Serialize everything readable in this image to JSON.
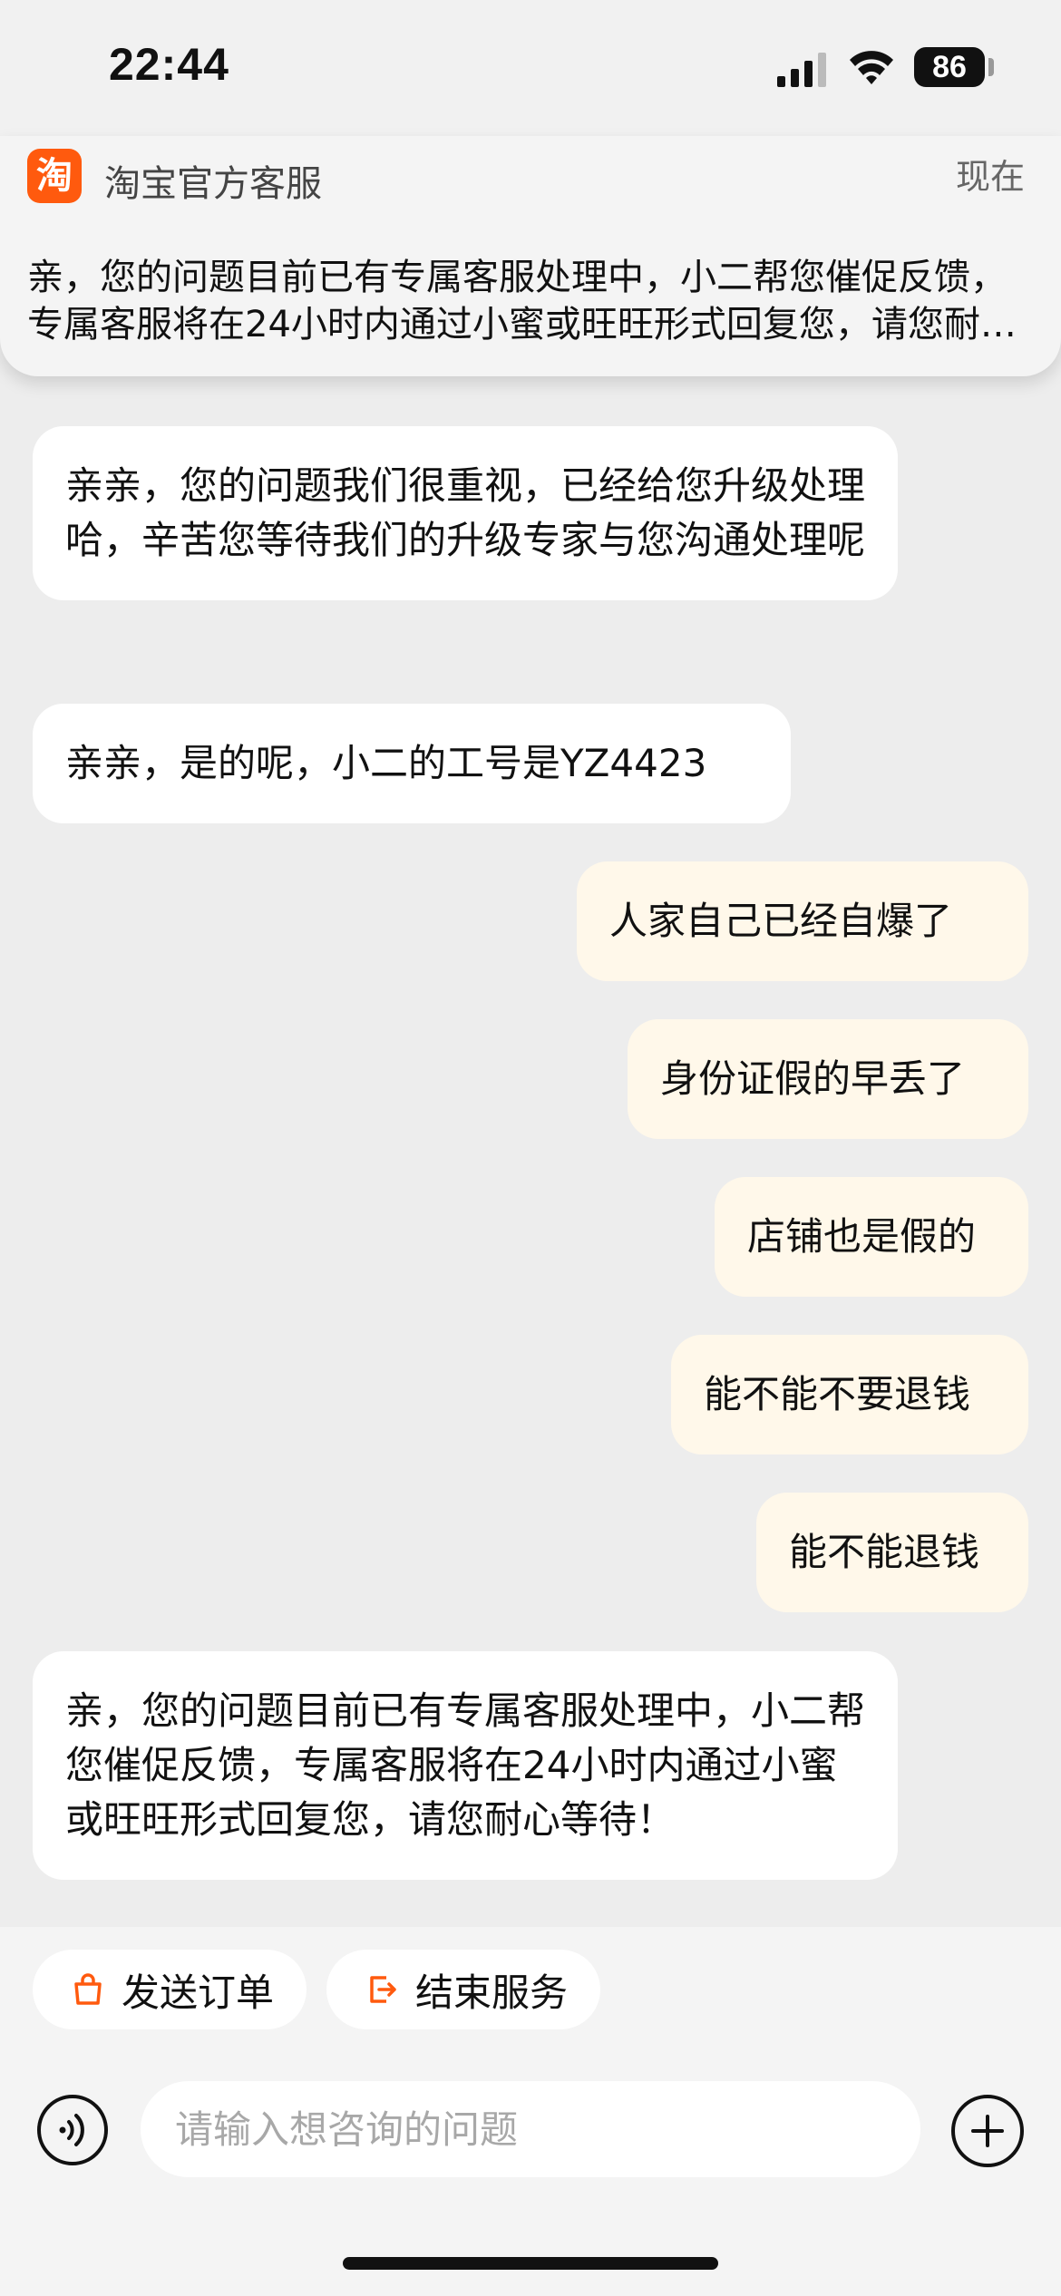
{
  "status_bar": {
    "time": "22:44",
    "battery": "86"
  },
  "notification": {
    "app_icon_char": "淘",
    "app_name": "淘宝官方客服",
    "time": "现在",
    "body": "亲，您的问题目前已有专属客服处理中，小二帮您催促反馈，专属客服将在24小时内通过小蜜或旺旺形式回复您，请您耐心等待！"
  },
  "messages": [
    {
      "from": "service",
      "text": "亲亲，您的问题我们很重视，已经给您升级处理哈，辛苦您等待我们的升级专家与您沟通处理呢"
    },
    {
      "from": "service",
      "text": "亲亲，是的呢，小二的工号是YZ4423"
    },
    {
      "from": "user",
      "text": "人家自己已经自爆了"
    },
    {
      "from": "user",
      "text": "身份证假的早丢了"
    },
    {
      "from": "user",
      "text": "店铺也是假的"
    },
    {
      "from": "user",
      "text": "能不能不要退钱"
    },
    {
      "from": "user",
      "text": "能不能退钱"
    },
    {
      "from": "service",
      "text": "亲，您的问题目前已有专属客服处理中，小二帮您催促反馈，专属客服将在24小时内通过小蜜或旺旺形式回复您，请您耐心等待！"
    }
  ],
  "quick_actions": {
    "send_order": "发送订单",
    "end_service": "结束服务"
  },
  "input": {
    "placeholder": "请输入想咨询的问题"
  },
  "icons": {
    "send_order": "shopping-bag-icon",
    "end_service": "exit-icon",
    "voice": "voice-wave-icon",
    "plus": "plus-icon"
  },
  "colors": {
    "brand_orange": "#ff5a0e",
    "user_bubble": "#fff8ea",
    "service_bubble": "#ffffff",
    "background": "#ededed"
  }
}
